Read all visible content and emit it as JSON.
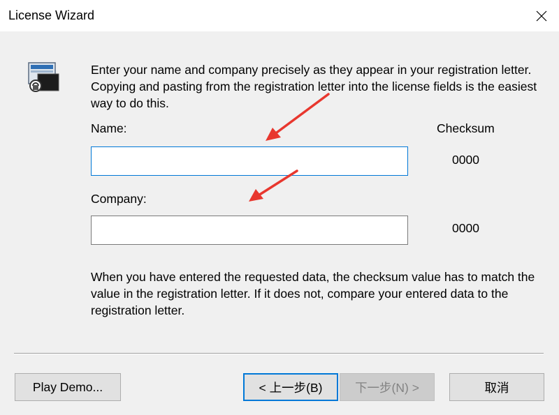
{
  "window": {
    "title": "License Wizard"
  },
  "intro_text": "Enter your name and company precisely as they appear in your registration letter.  Copying and pasting from the registration letter into the license fields is the easiest way to do this.",
  "fields": {
    "name_label": "Name:",
    "name_value": "",
    "company_label": "Company:",
    "company_value": ""
  },
  "checksum": {
    "header": "Checksum",
    "name_value": "0000",
    "company_value": "0000"
  },
  "outro_text": "When you have entered the requested data, the checksum value has to match the value in the registration letter.  If it does not, compare your entered data to the registration letter.",
  "buttons": {
    "demo": "Play Demo...",
    "back": "< 上一步(B)",
    "next": "下一步(N) >",
    "cancel": "取消"
  },
  "colors": {
    "focus_border": "#0078d7",
    "annotation_arrow": "#e8372e"
  }
}
